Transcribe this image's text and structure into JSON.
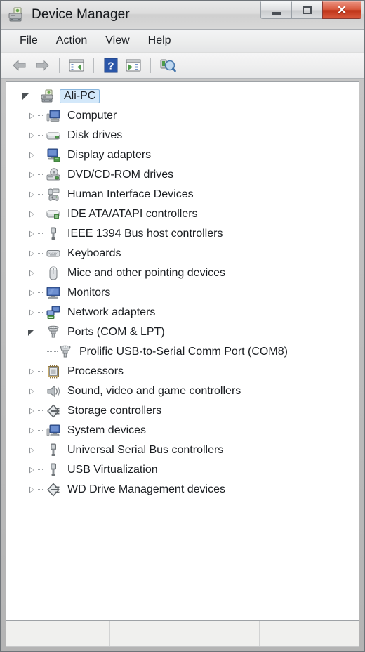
{
  "window": {
    "title": "Device Manager",
    "title_icon": "device-manager-icon",
    "controls": {
      "minimize": "minimize-icon",
      "maximize": "maximize-icon",
      "close": "close-icon",
      "close_glyph": "✕"
    }
  },
  "menu": {
    "items": [
      {
        "label": "File"
      },
      {
        "label": "Action"
      },
      {
        "label": "View"
      },
      {
        "label": "Help"
      }
    ]
  },
  "toolbar": {
    "buttons": [
      {
        "name": "back-button",
        "icon": "back-arrow-icon"
      },
      {
        "name": "forward-button",
        "icon": "forward-arrow-icon"
      },
      {
        "name": "separator-1",
        "icon": "separator"
      },
      {
        "name": "show-hide-console-tree-button",
        "icon": "console-tree-icon"
      },
      {
        "name": "separator-2",
        "icon": "separator"
      },
      {
        "name": "help-button",
        "icon": "question-mark-icon"
      },
      {
        "name": "properties-button",
        "icon": "properties-icon"
      },
      {
        "name": "separator-3",
        "icon": "separator"
      },
      {
        "name": "scan-for-hardware-changes-button",
        "icon": "scan-hardware-icon"
      }
    ]
  },
  "tree": {
    "root": {
      "label": "Ali-PC",
      "icon": "computer-root-icon",
      "expanded": true,
      "selected": true
    },
    "nodes": [
      {
        "label": "Computer",
        "icon": "computer-icon",
        "expanded": false
      },
      {
        "label": "Disk drives",
        "icon": "disk-drive-icon",
        "expanded": false
      },
      {
        "label": "Display adapters",
        "icon": "display-adapter-icon",
        "expanded": false
      },
      {
        "label": "DVD/CD-ROM drives",
        "icon": "dvd-cdrom-icon",
        "expanded": false
      },
      {
        "label": "Human Interface Devices",
        "icon": "hid-icon",
        "expanded": false
      },
      {
        "label": "IDE ATA/ATAPI controllers",
        "icon": "ide-controller-icon",
        "expanded": false
      },
      {
        "label": "IEEE 1394 Bus host controllers",
        "icon": "ieee1394-icon",
        "expanded": false
      },
      {
        "label": "Keyboards",
        "icon": "keyboard-icon",
        "expanded": false
      },
      {
        "label": "Mice and other pointing devices",
        "icon": "mouse-icon",
        "expanded": false
      },
      {
        "label": "Monitors",
        "icon": "monitor-icon",
        "expanded": false
      },
      {
        "label": "Network adapters",
        "icon": "network-adapter-icon",
        "expanded": false
      },
      {
        "label": "Ports (COM & LPT)",
        "icon": "serial-port-icon",
        "expanded": true,
        "children": [
          {
            "label": "Prolific USB-to-Serial Comm Port (COM8)",
            "icon": "serial-port-icon"
          }
        ]
      },
      {
        "label": "Processors",
        "icon": "processor-icon",
        "expanded": false
      },
      {
        "label": "Sound, video and game controllers",
        "icon": "sound-controller-icon",
        "expanded": false
      },
      {
        "label": "Storage controllers",
        "icon": "storage-controller-icon",
        "expanded": false
      },
      {
        "label": "System devices",
        "icon": "system-device-icon",
        "expanded": false
      },
      {
        "label": "Universal Serial Bus controllers",
        "icon": "usb-controller-icon",
        "expanded": false
      },
      {
        "label": "USB Virtualization",
        "icon": "usb-controller-icon",
        "expanded": false
      },
      {
        "label": "WD Drive Management devices",
        "icon": "storage-controller-icon",
        "expanded": false
      }
    ]
  },
  "statusbar": {
    "panes": [
      {
        "text": ""
      },
      {
        "text": ""
      },
      {
        "text": ""
      }
    ]
  },
  "colors": {
    "selection_fill": "#d3e8fa",
    "selection_border": "#8ab6dd",
    "close_button": "#bf3418",
    "monitor_blue": "#3b5fa8",
    "accent_green": "#3f9b43"
  }
}
